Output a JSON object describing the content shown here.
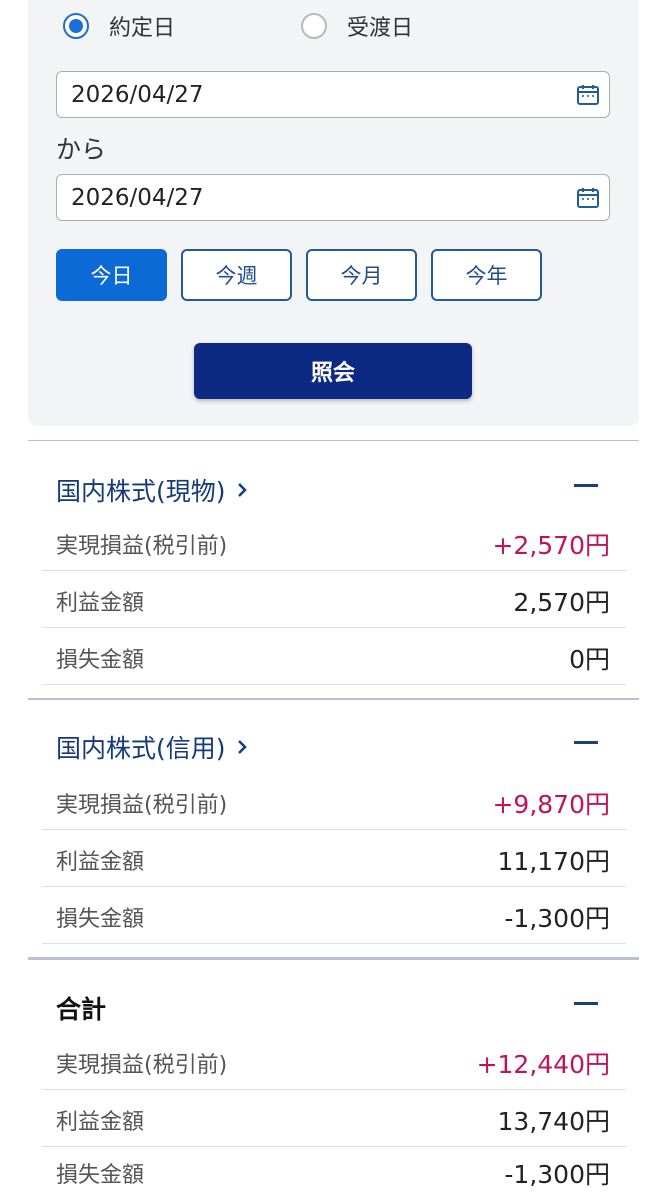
{
  "radio": {
    "options": [
      {
        "label": "約定日",
        "checked": true
      },
      {
        "label": "受渡日",
        "checked": false
      }
    ]
  },
  "date_from": {
    "value": "2026/04/27"
  },
  "range_separator": "から",
  "date_to": {
    "value": "2026/04/27"
  },
  "period_buttons": [
    {
      "label": "今日",
      "active": true
    },
    {
      "label": "今週",
      "active": false
    },
    {
      "label": "今月",
      "active": false
    },
    {
      "label": "今年",
      "active": false
    }
  ],
  "query_button": {
    "label": "照会"
  },
  "sections": [
    {
      "title": "国内株式(現物)",
      "rows": [
        {
          "label": "実現損益(税引前)",
          "value": "+2,570円"
        },
        {
          "label": "利益金額",
          "value": "2,570円"
        },
        {
          "label": "損失金額",
          "value": "0円"
        }
      ]
    },
    {
      "title": "国内株式(信用)",
      "rows": [
        {
          "label": "実現損益(税引前)",
          "value": "+9,870円"
        },
        {
          "label": "利益金額",
          "value": "11,170円"
        },
        {
          "label": "損失金額",
          "value": "-1,300円"
        }
      ]
    },
    {
      "title": "合計",
      "rows": [
        {
          "label": "実現損益(税引前)",
          "value": "+12,440円"
        },
        {
          "label": "利益金額",
          "value": "13,740円"
        },
        {
          "label": "損失金額",
          "value": "-1,300円"
        }
      ]
    }
  ],
  "colors": {
    "accent": "#0b6ad6",
    "primary_dark": "#0c2a82",
    "profit": "#c0125e",
    "title": "#143a7b"
  },
  "icons": {
    "calendar": "calendar-icon",
    "chevron": "chevron-right-icon",
    "collapse": "minus-icon"
  }
}
